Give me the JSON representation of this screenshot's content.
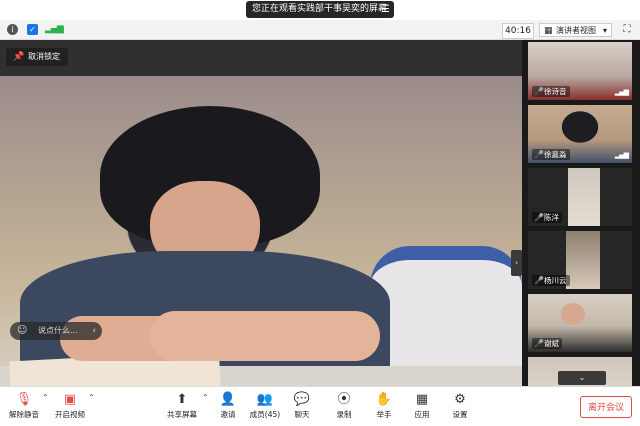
{
  "banner": {
    "text": "您正在观看实践部干事吴奕的屏幕",
    "menu_icon": "menu-icon"
  },
  "toolbar": {
    "timer": "40:16",
    "view_mode": "演讲者视图",
    "view_caret": "▾"
  },
  "colors": {
    "accent_red": "#e24b4b",
    "muted_red": "#ff4d4d",
    "banner_bg": "#262626",
    "bar_bg": "#ffffff",
    "sidebar_bg": "#1a1a1a"
  },
  "main": {
    "unpin_label": "取消锁定",
    "chat_placeholder": "说点什么...",
    "chat_arrow": "‹",
    "side_arrow": "›"
  },
  "participants": [
    {
      "name": "徐诗音",
      "muted": true,
      "signal": true
    },
    {
      "name": "徐嘉淼",
      "muted": true,
      "signal": true
    },
    {
      "name": "陈洋",
      "muted": true,
      "signal": false
    },
    {
      "name": "杨川云",
      "muted": true,
      "signal": false
    },
    {
      "name": "谢斌",
      "muted": true,
      "signal": false
    }
  ],
  "sidebar": {
    "scroll_glyph": "⌄"
  },
  "bottom": {
    "unmute": "解除静音",
    "start_video": "开启视频",
    "share_screen": "共享屏幕",
    "invite": "邀请",
    "participants": "成员(45)",
    "chat": "聊天",
    "record": "录制",
    "raise_hand": "举手",
    "apps": "应用",
    "settings": "设置",
    "leave": "离开会议"
  }
}
